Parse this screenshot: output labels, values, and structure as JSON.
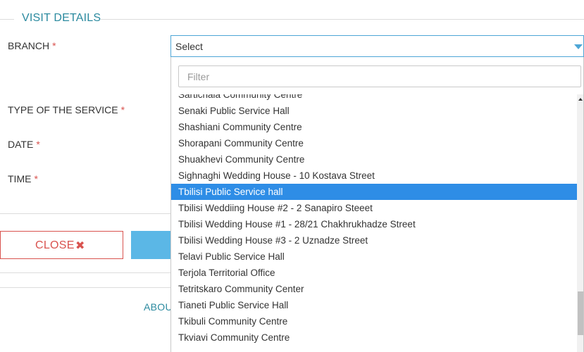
{
  "section": {
    "title": "VISIT DETAILS"
  },
  "fields": {
    "branch_label": "BRANCH",
    "service_label": "TYPE OF THE SERVICE",
    "date_label": "DATE",
    "time_label": "TIME",
    "required_marker": "*"
  },
  "branch_select": {
    "value": "Select",
    "filter_placeholder": "Filter",
    "options": [
      "Sartichala Community Centre",
      "Senaki Public Service Hall",
      "Shashiani Community Centre",
      "Shorapani Community Centre",
      "Shuakhevi Community Centre",
      "Sighnaghi Wedding House - 10 Kostava Street",
      "Tbilisi Public Service hall",
      "Tbilisi Weddiing House #2 - 2 Sanapiro Steeet",
      "Tbilisi Wedding House #1 - 28/21 Chakhrukhadze Street",
      "Tbilisi Wedding House #3 - 2 Uznadze Street",
      "Telavi Public Service Hall",
      "Terjola Territorial Office",
      "Tetritskaro Community Center",
      "Tianeti Public Service Hall",
      "Tkibuli Community Centre",
      "Tkviavi Community Centre"
    ],
    "highlighted": "Tbilisi Public Service hall"
  },
  "buttons": {
    "close_label": "CLOSE",
    "close_icon": "✖"
  },
  "footer": {
    "about_link": "ABOU"
  },
  "colors": {
    "accent": "#2b8a9f",
    "selection": "#2e8de6",
    "close": "#d9534f",
    "primary": "#5bb7e6"
  }
}
